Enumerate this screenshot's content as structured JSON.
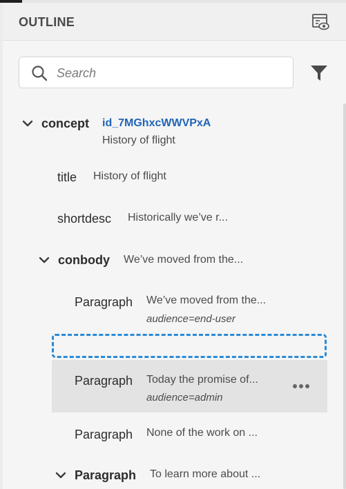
{
  "panel": {
    "title": "OUTLINE",
    "header_icon": "outline-view-settings-icon"
  },
  "search": {
    "placeholder": "Search",
    "value": ""
  },
  "filter_icon": "filter-icon",
  "tree": {
    "concept": {
      "tag": "concept",
      "id": "id_7MGhxcWWVPxA",
      "text": "History of flight"
    },
    "title": {
      "tag": "title",
      "text": "History of flight"
    },
    "shortdesc": {
      "tag": "shortdesc",
      "text": "Historically we’ve r..."
    },
    "conbody": {
      "tag": "conbody",
      "text": "We’ve moved from the..."
    },
    "para1": {
      "tag": "Paragraph",
      "text": "We’ve moved from the...",
      "attr": "audience=end-user"
    },
    "para2": {
      "tag": "Paragraph",
      "text": "Today the promise of...",
      "attr": "audience=admin"
    },
    "para3": {
      "tag": "Paragraph",
      "text": "None of the work on ..."
    },
    "para4": {
      "tag": "Paragraph",
      "text": "To learn more about ..."
    }
  },
  "colors": {
    "accent": "#1f64b7",
    "drop_zone": "#2a8ad6",
    "selected_row": "#e3e3e3",
    "panel_bg": "#f5f5f5"
  }
}
